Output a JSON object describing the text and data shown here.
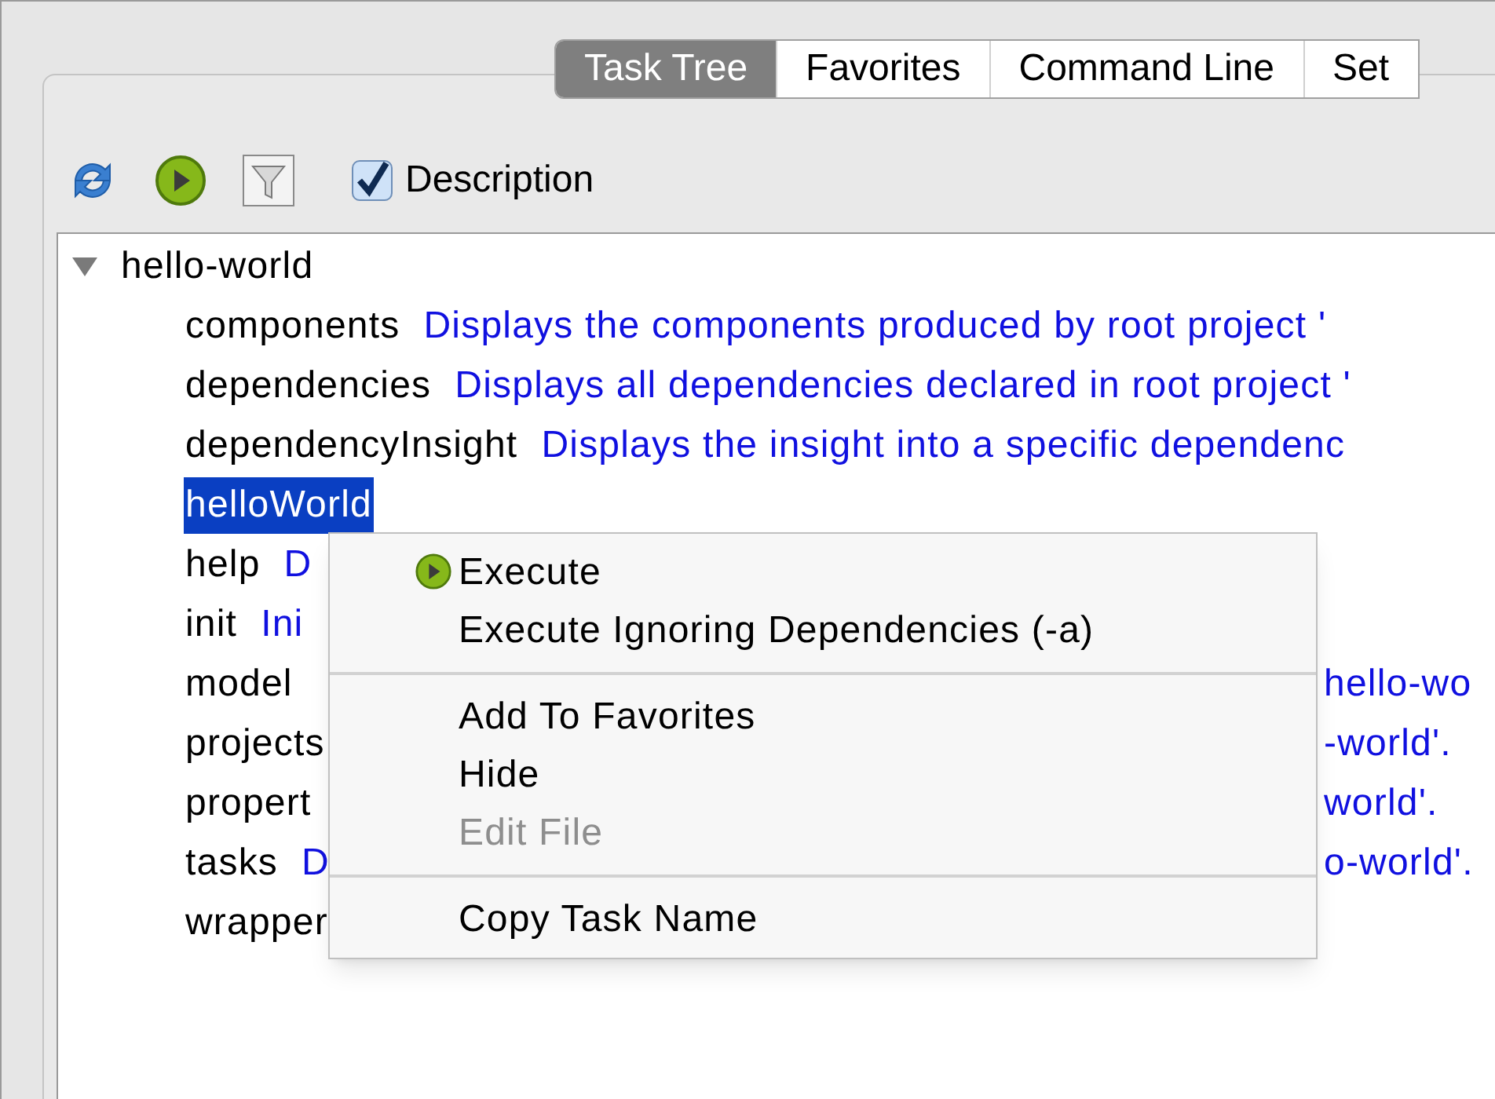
{
  "tabs": [
    {
      "label": "Task Tree",
      "selected": true
    },
    {
      "label": "Favorites",
      "selected": false
    },
    {
      "label": "Command Line",
      "selected": false
    },
    {
      "label": "Set",
      "selected": false
    }
  ],
  "toolbar": {
    "description_checkbox": {
      "label": "Description",
      "checked": true
    }
  },
  "tree": [
    {
      "name": "hello-world",
      "expanded": true,
      "children": [
        {
          "name": "components",
          "description": "Displays the components produced by root project '",
          "selected": false
        },
        {
          "name": "dependencies",
          "description": "Displays all dependencies declared in root project '",
          "selected": false
        },
        {
          "name": "dependencyInsight",
          "description": "Displays the insight into a specific dependenc",
          "selected": false
        },
        {
          "name": "helloWorld",
          "selected": true
        },
        {
          "name": "help",
          "description": "D",
          "selected": false
        },
        {
          "name": "init",
          "description": "Ini",
          "selected": false
        },
        {
          "name": "model",
          "description_tail": "hello-wo",
          "selected": false
        },
        {
          "name": "projects",
          "description_tail": "-world'.",
          "selected": false
        },
        {
          "name": "propert",
          "description_tail": "world'.",
          "selected": false
        },
        {
          "name": "tasks",
          "description": "D",
          "description_tail": "o-world'.",
          "selected": false
        },
        {
          "name": "wrapper",
          "selected": false
        }
      ]
    }
  ],
  "context_menu": [
    {
      "kind": "icon_item",
      "label": "Execute",
      "disabled": false
    },
    {
      "kind": "item",
      "label": "Execute Ignoring Dependencies (-a)",
      "disabled": false
    },
    {
      "kind": "separator"
    },
    {
      "kind": "item",
      "label": "Add To Favorites",
      "disabled": false
    },
    {
      "kind": "item",
      "label": "Hide",
      "disabled": false
    },
    {
      "kind": "item",
      "label": "Edit File",
      "disabled": true
    },
    {
      "kind": "separator"
    },
    {
      "kind": "item",
      "label": "Copy Task Name",
      "disabled": false
    }
  ]
}
